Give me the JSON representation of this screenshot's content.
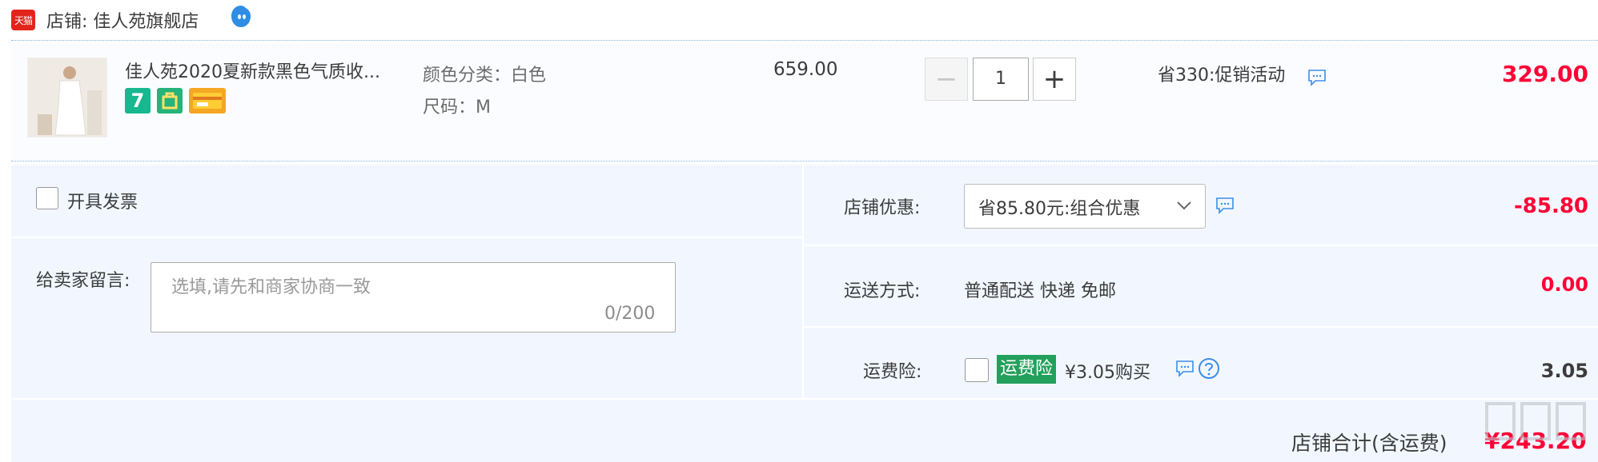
{
  "header": {
    "logo_text": "天猫",
    "shop_name": "店铺: 佳人苑旗舰店"
  },
  "item": {
    "title": "佳人苑2020夏新款黑色气质收...",
    "badge_seven": "7",
    "sku_color": "颜色分类：白色",
    "sku_size": "尺码：M",
    "unit_price": "659.00",
    "quantity": "1",
    "qty_minus": "−",
    "qty_plus": "+",
    "promo_text": "省330:促销活动",
    "subtotal": "329.00"
  },
  "invoice": {
    "label": "开具发票"
  },
  "message": {
    "label": "给卖家留言:",
    "placeholder": "选填,请先和商家协商一致",
    "counter": "0/200"
  },
  "shop_discount": {
    "label": "店铺优惠:",
    "selected": "省85.80元:组合优惠",
    "amount": "-85.80"
  },
  "shipping": {
    "label": "运送方式:",
    "method": "普通配送 快递 免邮",
    "amount": "0.00"
  },
  "insurance": {
    "label": "运费险:",
    "badge": "运费险",
    "price_text": "¥3.05购买",
    "amount": "3.05"
  },
  "total": {
    "label": "店铺合计(含运费)",
    "value": "¥243.20"
  },
  "colors": {
    "accent_red": "#ff0036",
    "insurance_green": "#23a05c",
    "panel_bg": "#f2f7ff",
    "link_blue": "#3d8ee8"
  }
}
